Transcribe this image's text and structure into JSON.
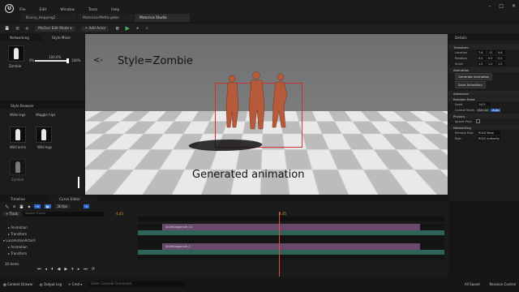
{
  "menu": [
    "File",
    "Edit",
    "Window",
    "Tools",
    "Help"
  ],
  "tabs": [
    "Bunny_Hopping2",
    "Motorica-Metta-gebe",
    "Motorica Studio"
  ],
  "toolbar": {
    "mode": "MoGen Edit Mode",
    "add_actor": "Add Actor"
  },
  "left_top": {
    "tabs": [
      "Networking",
      "Style Mixer"
    ],
    "style_name": "Zombie",
    "slider_min": "0%",
    "slider_value": "100.0%",
    "slider_max": "100%"
  },
  "style_browser": {
    "title": "Style Browser",
    "items": [
      "Wide legs",
      "Waggle hips",
      "Wild arms",
      "Wild legs",
      "Zombie"
    ]
  },
  "viewport": {
    "caption_top": "Style=Zombie",
    "arrow": "<-",
    "caption_bottom": "Generated animation"
  },
  "details": {
    "title": "Details",
    "sections": [
      "Transform",
      "Animation",
      "Advanced",
      "Random Seed",
      "Physics",
      "Networking"
    ],
    "transform_rows": [
      "Location",
      "Rotation",
      "Scale"
    ],
    "location": [
      "7.6",
      "-11",
      "4.6"
    ],
    "rotation": [
      "0.0",
      "0.0",
      "0.0"
    ],
    "scale": [
      "1.0",
      "1.0",
      "1.0"
    ],
    "buttons": [
      "Generate Animation",
      "Save Animation"
    ],
    "seed_label": "Seed",
    "seed_value": "1413",
    "control_label": "Control Mode",
    "control_options": [
      "Manual",
      "Auto"
    ],
    "physics_label": "Ignore Phys",
    "net_labels": [
      "Remote Role",
      "Role"
    ],
    "net_values": [
      "ROLE None",
      "ROLE Authority"
    ]
  },
  "timeline": {
    "tabs": [
      "Timeline",
      "Curve Editor"
    ],
    "fps": "30 fps",
    "track_button": "+ Track",
    "search_placeholder": "Search Tracks",
    "frame": "4.45",
    "tracks": [
      "Animation",
      "Transform",
      "LocomotionActor0",
      "Animation",
      "Transform"
    ],
    "sections": [
      "AnimSequence_11",
      "AnimSequence_1"
    ],
    "count": "30 items"
  },
  "statusbar": {
    "items": [
      "Content Drawer",
      "Output Log",
      "Cmd"
    ],
    "cmd_placeholder": "Enter Console Command",
    "right": [
      "All Saved",
      "Revision Control"
    ]
  }
}
